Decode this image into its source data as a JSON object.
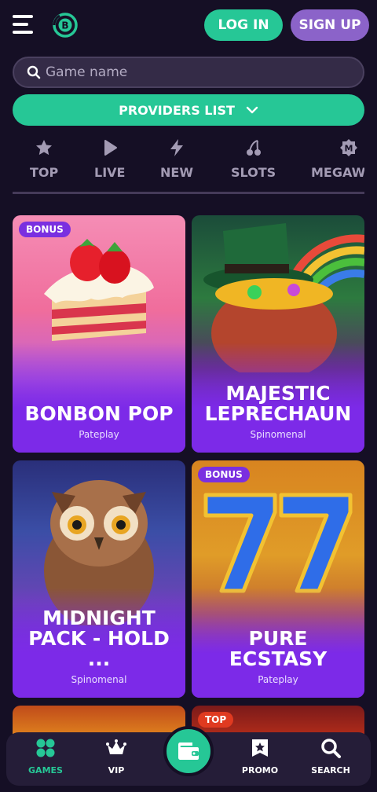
{
  "header": {
    "login_label": "LOG IN",
    "signup_label": "SIGN UP",
    "logo_letter": "B"
  },
  "search": {
    "placeholder": "Game name",
    "value": ""
  },
  "providers": {
    "label": "PROVIDERS LIST"
  },
  "categories": [
    {
      "label": "TOP",
      "icon": "star-icon"
    },
    {
      "label": "LIVE",
      "icon": "play-icon"
    },
    {
      "label": "NEW",
      "icon": "lightning-icon"
    },
    {
      "label": "SLOTS",
      "icon": "cherry-icon"
    },
    {
      "label": "MEGAWA",
      "icon": "megaways-icon"
    }
  ],
  "games": [
    {
      "title": "BONBON POP",
      "provider": "Pateplay",
      "badge": "BONUS"
    },
    {
      "title": "MAJESTIC LEPRECHAUN",
      "provider": "Spinomenal",
      "badge": ""
    },
    {
      "title": "MIDNIGHT PACK - HOLD ...",
      "provider": "Spinomenal",
      "badge": ""
    },
    {
      "title": "PURE ECSTASY",
      "provider": "Pateplay",
      "badge": "BONUS"
    },
    {
      "title": "",
      "provider": "",
      "badge": ""
    },
    {
      "title": "",
      "provider": "",
      "badge": "TOP"
    }
  ],
  "bottom_nav": [
    {
      "label": "GAMES",
      "icon": "grid-icon",
      "active": true
    },
    {
      "label": "VIP",
      "icon": "crown-icon",
      "active": false
    },
    {
      "label": "PROMO",
      "icon": "promo-icon",
      "active": false
    },
    {
      "label": "SEARCH",
      "icon": "search-icon",
      "active": false
    }
  ],
  "colors": {
    "background": "#150f25",
    "accent_green": "#26c796",
    "accent_purple": "#8b63c9",
    "card_purple": "#7c2ae8"
  }
}
